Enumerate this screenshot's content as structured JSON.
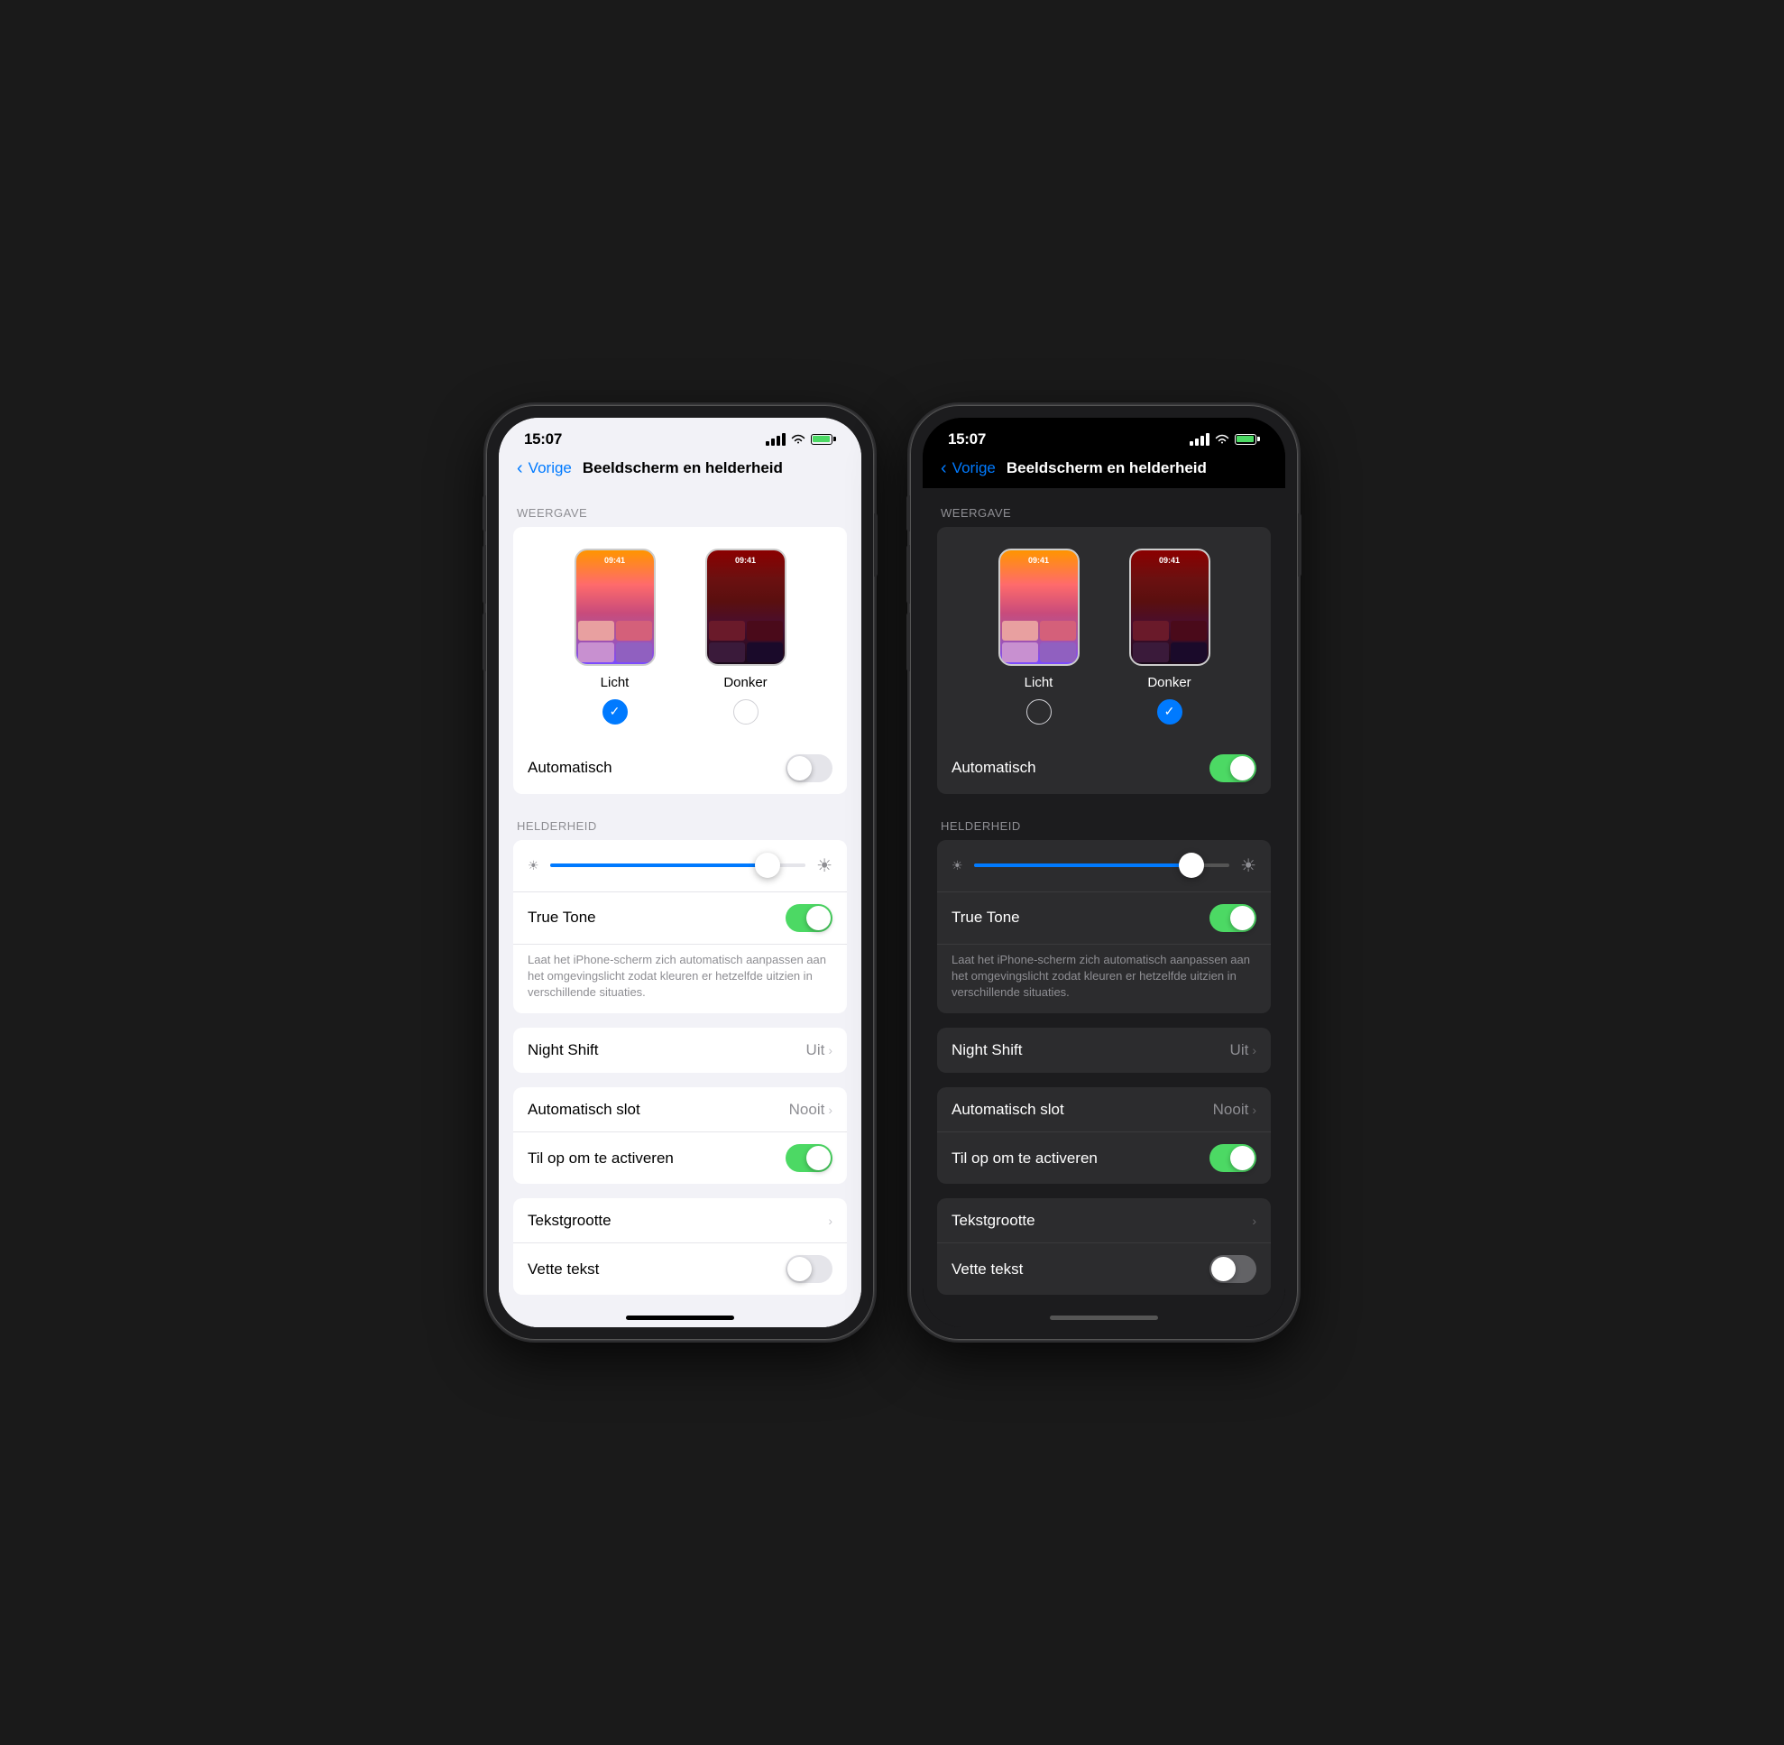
{
  "phones": [
    {
      "id": "light",
      "theme": "light",
      "status": {
        "time": "15:07"
      },
      "nav": {
        "back_label": "Vorige",
        "title": "Beeldscherm en helderheid"
      },
      "sections": [
        {
          "header": "WEERGAVE",
          "type": "display_mode",
          "modes": [
            {
              "label": "Licht",
              "selected": true,
              "style": "light"
            },
            {
              "label": "Donker",
              "selected": false,
              "style": "dark"
            }
          ],
          "automatisch": {
            "label": "Automatisch",
            "enabled": false
          }
        },
        {
          "header": "HELDERHEID",
          "type": "helderheid",
          "brightness_pct": 85,
          "true_tone": {
            "label": "True Tone",
            "enabled": true,
            "description": "Laat het iPhone-scherm zich automatisch aanpassen aan het omgevingslicht zodat kleuren er hetzelfde uitzien in verschillende situaties."
          }
        },
        {
          "type": "menu_rows",
          "rows": [
            {
              "label": "Night Shift",
              "value": "Uit",
              "has_chevron": true
            },
            {
              "label": "Automatisch slot",
              "value": "Nooit",
              "has_chevron": true
            },
            {
              "label": "Til op om te activeren",
              "value": "",
              "toggle": true,
              "toggle_on": true
            },
            {
              "label": "Tekstgrootte",
              "value": "",
              "has_chevron": true
            },
            {
              "label": "Vette tekst",
              "value": "",
              "toggle": true,
              "toggle_on": false
            }
          ]
        }
      ]
    },
    {
      "id": "dark",
      "theme": "dark",
      "status": {
        "time": "15:07"
      },
      "nav": {
        "back_label": "Vorige",
        "title": "Beeldscherm en helderheid"
      },
      "sections": [
        {
          "header": "WEERGAVE",
          "type": "display_mode",
          "modes": [
            {
              "label": "Licht",
              "selected": false,
              "style": "light"
            },
            {
              "label": "Donker",
              "selected": true,
              "style": "dark"
            }
          ],
          "automatisch": {
            "label": "Automatisch",
            "enabled": true
          }
        },
        {
          "header": "HELDERHEID",
          "type": "helderheid",
          "brightness_pct": 85,
          "true_tone": {
            "label": "True Tone",
            "enabled": true,
            "description": "Laat het iPhone-scherm zich automatisch aanpassen aan het omgevingslicht zodat kleuren er hetzelfde uitzien in verschillende situaties."
          }
        },
        {
          "type": "menu_rows",
          "rows": [
            {
              "label": "Night Shift",
              "value": "Uit",
              "has_chevron": true
            },
            {
              "label": "Automatisch slot",
              "value": "Nooit",
              "has_chevron": true
            },
            {
              "label": "Til op om te activeren",
              "value": "",
              "toggle": true,
              "toggle_on": true
            },
            {
              "label": "Tekstgrootte",
              "value": "",
              "has_chevron": true
            },
            {
              "label": "Vette tekst",
              "value": "",
              "toggle": true,
              "toggle_on": false
            }
          ]
        }
      ]
    }
  ]
}
